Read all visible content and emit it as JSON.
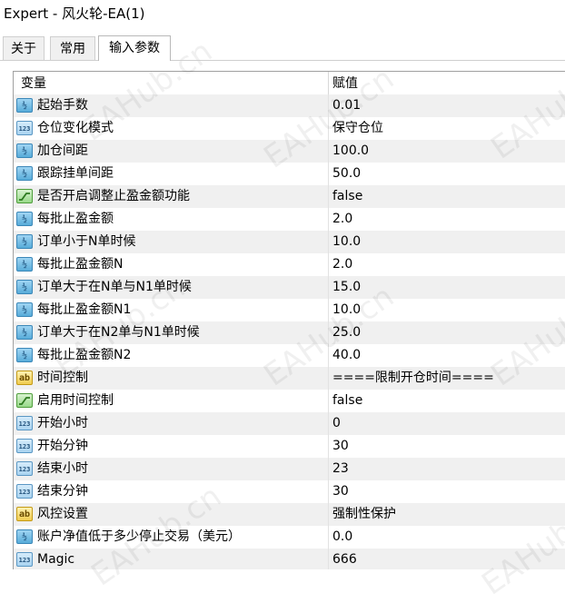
{
  "window": {
    "title": "Expert - 风火轮-EA(1)"
  },
  "tabs": [
    {
      "label": "关于"
    },
    {
      "label": "常用"
    },
    {
      "label": "输入参数"
    }
  ],
  "grid": {
    "headers": {
      "variable": "变量",
      "value": "赋值"
    },
    "rows": [
      {
        "name": "起始手数",
        "value": "0.01",
        "icon": "double-type-icon"
      },
      {
        "name": "仓位变化模式",
        "value": "保守仓位",
        "icon": "integer-type-icon"
      },
      {
        "name": "加仓间距",
        "value": "100.0",
        "icon": "double-type-icon"
      },
      {
        "name": "跟踪挂单间距",
        "value": "50.0",
        "icon": "double-type-icon"
      },
      {
        "name": "是否开启调整止盈金额功能",
        "value": "false",
        "icon": "bool-type-icon"
      },
      {
        "name": "每批止盈金额",
        "value": "2.0",
        "icon": "double-type-icon"
      },
      {
        "name": "订单小于N单时候",
        "value": "10.0",
        "icon": "double-type-icon"
      },
      {
        "name": "每批止盈金额N",
        "value": "2.0",
        "icon": "double-type-icon"
      },
      {
        "name": "订单大于在N单与N1单时候",
        "value": "15.0",
        "icon": "double-type-icon"
      },
      {
        "name": "每批止盈金额N1",
        "value": "10.0",
        "icon": "double-type-icon"
      },
      {
        "name": "订单大于在N2单与N1单时候",
        "value": "25.0",
        "icon": "double-type-icon"
      },
      {
        "name": "每批止盈金额N2",
        "value": "40.0",
        "icon": "double-type-icon"
      },
      {
        "name": "时间控制",
        "value": "====限制开仓时间====",
        "icon": "string-type-icon"
      },
      {
        "name": "启用时间控制",
        "value": "false",
        "icon": "bool-type-icon"
      },
      {
        "name": "开始小时",
        "value": "0",
        "icon": "integer-type-icon"
      },
      {
        "name": "开始分钟",
        "value": "30",
        "icon": "integer-type-icon"
      },
      {
        "name": "结束小时",
        "value": "23",
        "icon": "integer-type-icon"
      },
      {
        "name": "结束分钟",
        "value": "30",
        "icon": "integer-type-icon"
      },
      {
        "name": "风控设置",
        "value": "强制性保护",
        "icon": "string-type-icon"
      },
      {
        "name": "账户净值低于多少停止交易（美元）",
        "value": "0.0",
        "icon": "double-type-icon"
      },
      {
        "name": "Magic",
        "value": "666",
        "icon": "integer-type-icon"
      }
    ]
  },
  "icon_glyphs": {
    "double": "½",
    "integer": "123",
    "string": "ab"
  },
  "watermark": "EAHub.cn"
}
